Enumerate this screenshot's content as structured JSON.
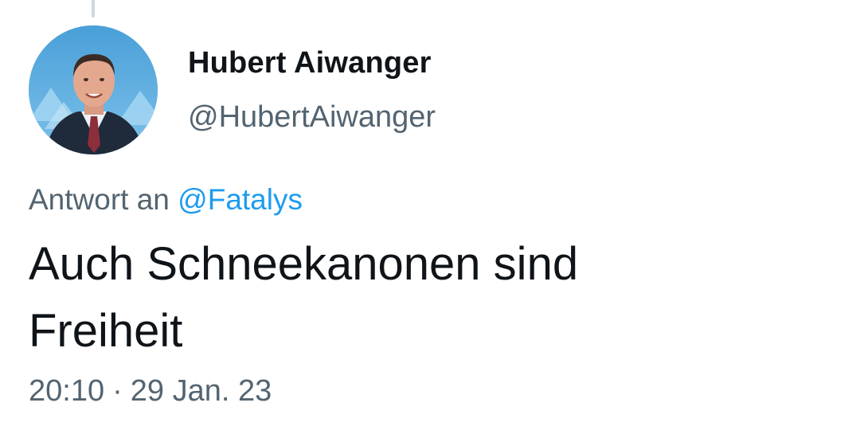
{
  "tweet": {
    "author": {
      "display_name": "Hubert Aiwanger",
      "handle": "@HubertAiwanger"
    },
    "reply": {
      "prefix": "Antwort an",
      "mention": "@Fatalys"
    },
    "text_lines": [
      "Auch Schneekanonen sind",
      "Freiheit"
    ],
    "time": "20:10",
    "separator": "·",
    "date": "29 Jan. 23"
  },
  "colors": {
    "text_primary": "#0f1419",
    "text_secondary": "#536471",
    "link": "#1d9bf0",
    "thread_line": "#cfd9de"
  }
}
